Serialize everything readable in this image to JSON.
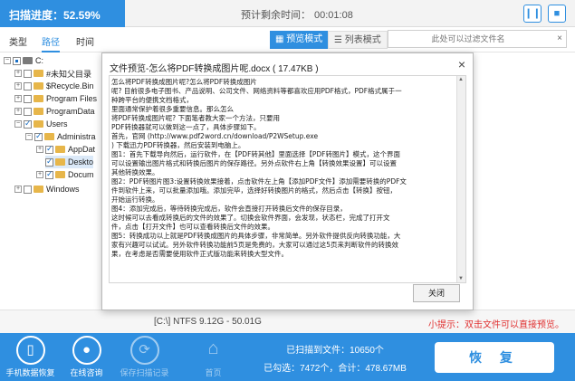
{
  "topbar": {
    "progress_label": "扫描进度：52.59%",
    "progress_fraction": 0.5259,
    "remaining_label": "预计剩余时间：",
    "remaining_time": "00:01:08",
    "pause_glyph": "❙❙",
    "stop_glyph": "■"
  },
  "tabs": [
    {
      "label": "类型"
    },
    {
      "label": "路径"
    },
    {
      "label": "时间"
    }
  ],
  "view_modes": {
    "preview_label": "预览模式",
    "list_label": "列表模式"
  },
  "search": {
    "placeholder": "此处可以过滤文件名",
    "icon": "search-icon",
    "clear_glyph": "×",
    "search_glyph": "🔍"
  },
  "tree": [
    {
      "label": "C:"
    },
    {
      "label": "#未知父目录"
    },
    {
      "label": "$Recycle.Bin"
    },
    {
      "label": "Program Files"
    },
    {
      "label": "ProgramData"
    },
    {
      "label": "Users"
    },
    {
      "label": "Administra"
    },
    {
      "label": "AppDat"
    },
    {
      "label": "Deskto"
    },
    {
      "label": "Docum"
    },
    {
      "label": "Windows"
    }
  ],
  "status": {
    "drive_info": "[C:\\] NTFS 9.12G - 50.01G",
    "tip": "小提示：双击文件可以直接预览。"
  },
  "bottom": {
    "phone_recovery": "手机数据恢复",
    "online_consult": "在线咨询",
    "save_progress": "保存扫描记录",
    "home": "首页",
    "found_label": "已扫描到文件：",
    "found_count": "10650个",
    "selected_label": "已勾选：",
    "selected_count": "7472个",
    "total_label": "合计：",
    "total_size": "478.67MB",
    "restore_label": "恢 复"
  },
  "dialog": {
    "title": "文件预览-怎么将PDF转换成图片呢.docx ( 17.47KB )",
    "close_glyph": "×",
    "close_button": "关闭",
    "content": "怎么将PDF转换成图片呢?怎么将PDF转换成图片\n呢? 目前很多电子图书、产品说明、公司文件、网络资料等都喜欢应用PDF格式，PDF格式属于一\n种跨平台的便携文档格式，\n里面通常保护着很多重要信息。那么怎么\n将PDF转换成图片呢? 下面笔者教大家一个方法，只要用\nPDF转换器就可以做到这一点了，具体步骤如下。\n首先，官网 (http://www.pdf2word.cn/download/P2WSetup.exe\n) 下载迅力PDF转换器，然后安装到电脑上。\n图1：首先下载导向然后，运行软件，在【PDF转其他】里面选择【PDF转图片】模式，这个界面\n可以设置输出图片格式和转换后图片的保存路径。另外点软件右上角【转换效果设置】可以设置\n其他转换效果。\n图2：PDF转图片图3:设置转换效果接着，点击软件左上角【添加PDF文件】添加需要转换的PDF文\n件到软件上来，可以批量添加哦。添加完毕，选择好转换图片的格式，然后点击【转换】按钮，\n开始运行转换。\n图4：添加完成后，等待转换完成后，软件会直接打开转换后文件的保存目录，\n这时候可以去看成转换后的文件的效果了。切换会软件界面，会发现，状态栏，完成了打开文\n件，点击【打开文件】也可以查看转换后文件的效果。\n图5：转换成功以上就是PDF转换成图片的具体步骤，非常简单。另外软件提供反向转换功能，大\n家有兴趣可以试试。另外软件转换功能前5页是免费的，大家可以通过这5页来判断软件的转换效\n果，在考虑是否需要使用软件正式版功能来转换大型文件。"
  },
  "colors": {
    "accent": "#2f8fe0",
    "tip": "#e03030",
    "folder": "#e7b64a"
  }
}
